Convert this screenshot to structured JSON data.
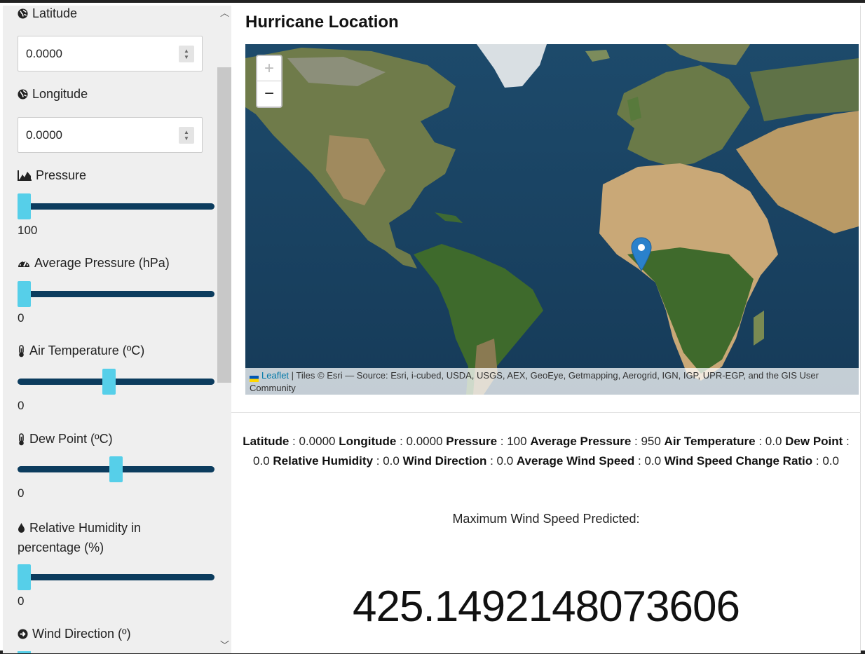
{
  "sidebar": {
    "latitude": {
      "label": "Latitude",
      "value": "0.0000"
    },
    "longitude": {
      "label": "Longitude",
      "value": "0.0000"
    },
    "pressure": {
      "label": "Pressure",
      "value": "100",
      "fraction": 0.0
    },
    "avg_pressure": {
      "label": "Average Pressure (hPa)",
      "value": "0",
      "fraction": 0.0
    },
    "air_temp": {
      "label": "Air Temperature (ºC)",
      "value": "0",
      "fraction": 0.46
    },
    "dew_point": {
      "label": "Dew Point (ºC)",
      "value": "0",
      "fraction": 0.5
    },
    "rel_humidity": {
      "label_line1": "Relative Humidity in",
      "label_line2": "percentage (%)",
      "value": "0",
      "fraction": 0.0
    },
    "wind_direction": {
      "label": "Wind Direction (º)"
    }
  },
  "main": {
    "title": "Hurricane Location",
    "map": {
      "zoom_in": "+",
      "zoom_out": "−",
      "attribution_link": "Leaflet",
      "attribution_text": "| Tiles © Esri — Source: Esri, i-cubed, USDA, USGS, AEX, GeoEye, Getmapping, Aerogrid, IGN, IGP, UPR-EGP, and the GIS User Community"
    },
    "summary": [
      {
        "key": "Latitude",
        "value": "0.0000"
      },
      {
        "key": "Longitude",
        "value": "0.0000"
      },
      {
        "key": "Pressure",
        "value": "100"
      },
      {
        "key": "Average Pressure",
        "value": "950"
      },
      {
        "key": "Air Temperature",
        "value": "0.0"
      },
      {
        "key": "Dew Point",
        "value": "0.0"
      },
      {
        "key": "Relative Humidity",
        "value": "0.0"
      },
      {
        "key": "Wind Direction",
        "value": "0.0"
      },
      {
        "key": "Average Wind Speed",
        "value": "0.0"
      },
      {
        "key": "Wind Speed Change Ratio",
        "value": "0.0"
      }
    ],
    "prediction_label": "Maximum Wind Speed Predicted:",
    "prediction_value": "425.1492148073606"
  },
  "colors": {
    "slider_track": "#0c3c5e",
    "slider_thumb": "#56cfe9",
    "marker": "#2a81cb"
  }
}
